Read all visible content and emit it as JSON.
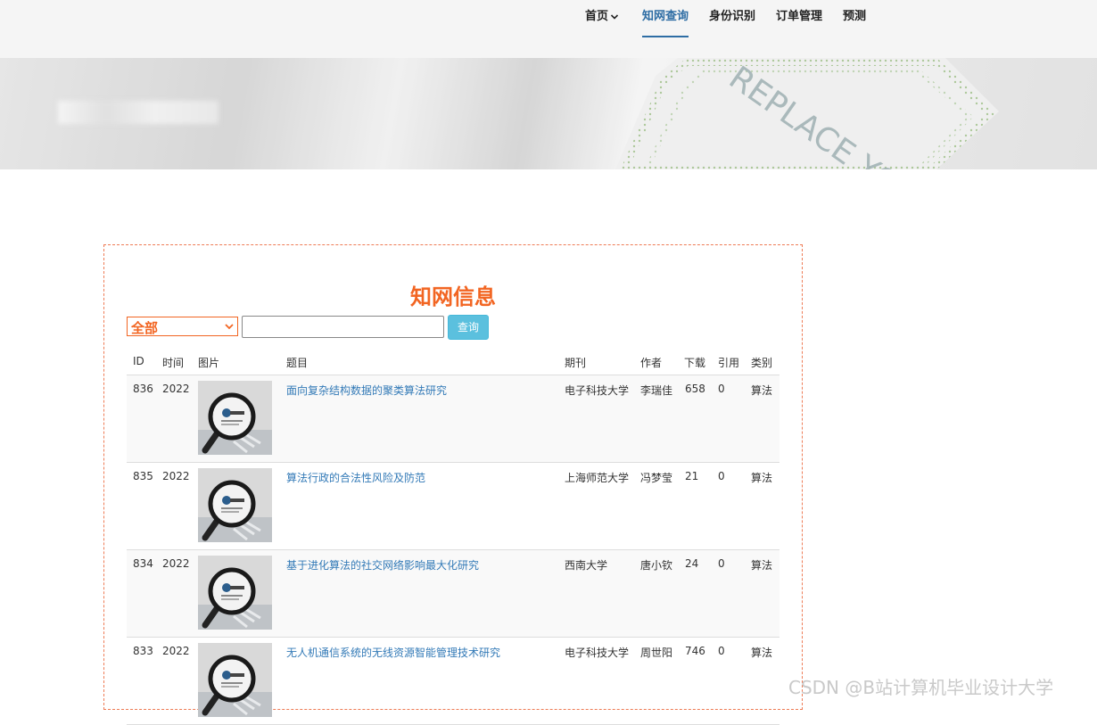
{
  "nav": {
    "items": [
      {
        "label": "首页"
      },
      {
        "label": "知网查询"
      },
      {
        "label": "身份识别"
      },
      {
        "label": "订单管理"
      },
      {
        "label": "预测"
      }
    ]
  },
  "banner": {
    "image_text": "REPLACE YOUR DESI"
  },
  "panel": {
    "title": "知网信息",
    "category_value": "全部",
    "search_value": "",
    "search_button": "查询"
  },
  "table": {
    "headers": [
      "ID",
      "时间",
      "图片",
      "题目",
      "期刊",
      "作者",
      "下载",
      "引用",
      "类别"
    ],
    "rows": [
      {
        "id": "836",
        "year": "2022",
        "title": "面向复杂结构数据的聚类算法研究",
        "journal": "电子科技大学",
        "author": "李瑞佳",
        "downloads": "658",
        "citations": "0",
        "category": "算法"
      },
      {
        "id": "835",
        "year": "2022",
        "title": "算法行政的合法性风险及防范",
        "journal": "上海师范大学",
        "author": "冯梦莹",
        "downloads": "21",
        "citations": "0",
        "category": "算法"
      },
      {
        "id": "834",
        "year": "2022",
        "title": "基于进化算法的社交网络影响最大化研究",
        "journal": "西南大学",
        "author": "唐小钦",
        "downloads": "24",
        "citations": "0",
        "category": "算法"
      },
      {
        "id": "833",
        "year": "2022",
        "title": "无人机通信系统的无线资源智能管理技术研究",
        "journal": "电子科技大学",
        "author": "周世阳",
        "downloads": "746",
        "citations": "0",
        "category": "算法"
      }
    ]
  },
  "watermark": "CSDN @B站计算机毕业设计大学",
  "colors": {
    "accent": "#f26522",
    "nav_active": "#2e6da4",
    "button": "#5bc0de",
    "link": "#337ab7"
  }
}
